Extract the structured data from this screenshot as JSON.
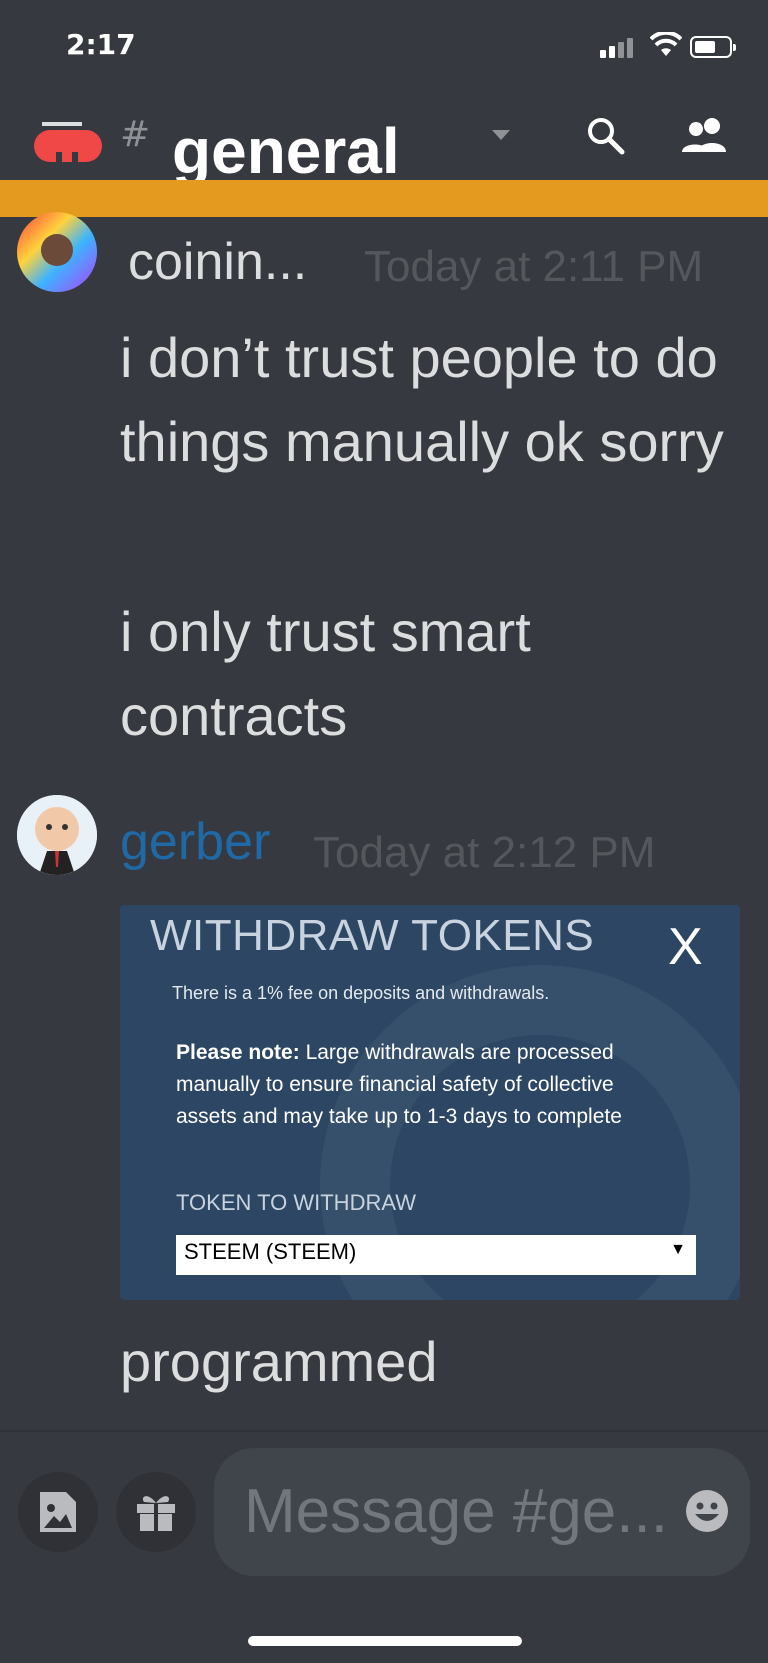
{
  "status_bar": {
    "time": "2:17"
  },
  "header": {
    "channel_title": "general"
  },
  "messages": [
    {
      "author": "coinin...",
      "author_color": "#ffffff",
      "timestamp": "Today at 2:11 PM",
      "lines": [
        "i don’t trust people to do things manually ok sorry",
        "i only trust smart contracts"
      ]
    },
    {
      "author": "gerber",
      "author_color": "#1f6aa6",
      "timestamp": "Today at 2:12 PM",
      "after_embed": "programmed"
    }
  ],
  "embed": {
    "title": "WITHDRAW TOKENS",
    "close": "X",
    "fee_text": "There is a 1% fee on deposits and withdrawals.",
    "note_label": "Please note:",
    "note_text": "Large withdrawals are processed manually to ensure financial safety of collective assets and may take up to 1-3 days to complete",
    "token_label": "TOKEN TO WITHDRAW",
    "token_selected": "STEEM (STEEM)"
  },
  "composer": {
    "placeholder": "Message #ge..."
  },
  "colors": {
    "banner": "#e39a1e",
    "background": "#36393f",
    "embed_bg": "#2c4663"
  }
}
